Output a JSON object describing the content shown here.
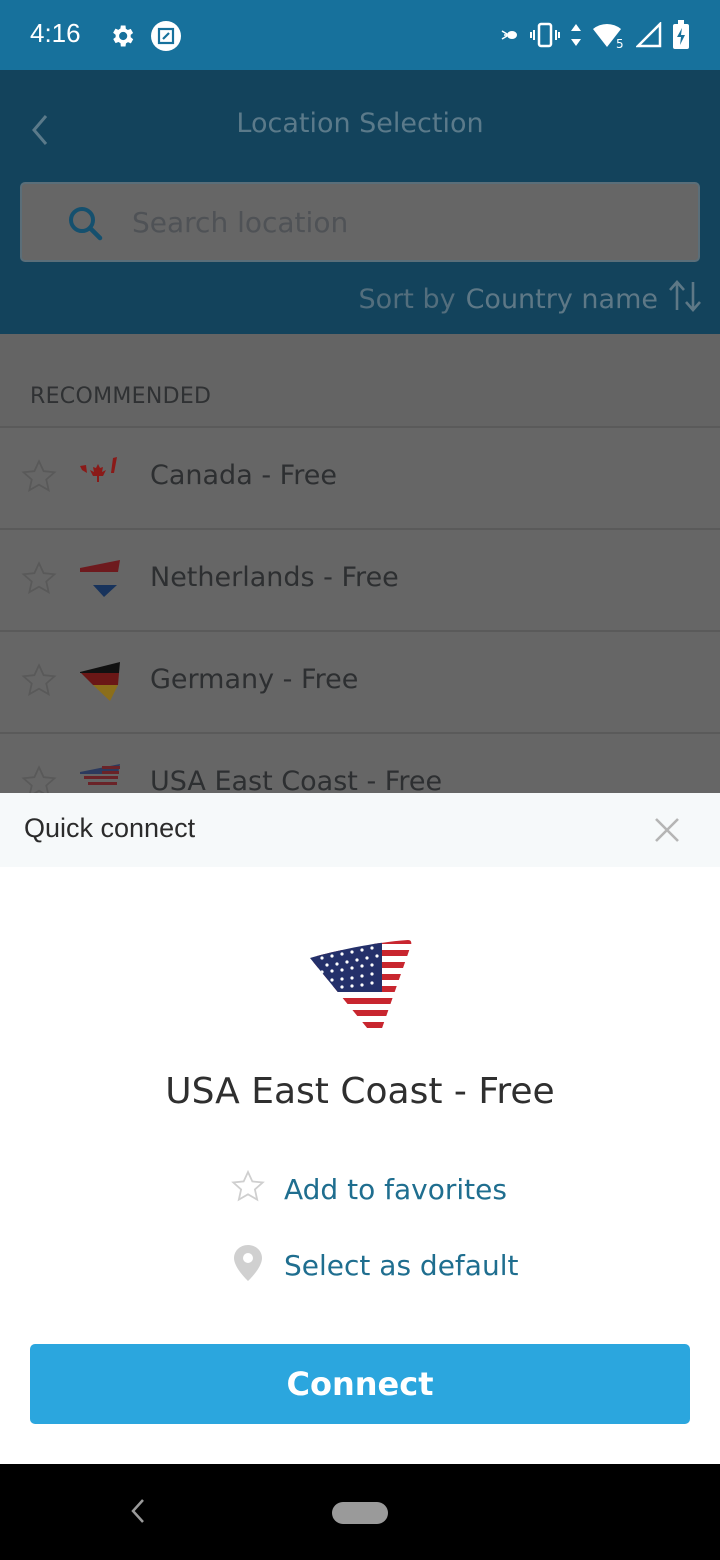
{
  "status_bar": {
    "time": "4:16",
    "left_icons": [
      "settings-icon",
      "screenshot-icon"
    ],
    "right_icons": [
      "bug-icon",
      "vibrate-icon",
      "data-arrows-icon",
      "wifi-icon",
      "signal-icon",
      "battery-charging-icon"
    ],
    "wifi_badge": "5"
  },
  "header": {
    "title": "Location Selection",
    "back_icon": "chevron-left-icon"
  },
  "search": {
    "placeholder": "Search location",
    "value": ""
  },
  "sort": {
    "label": "Sort by",
    "value": "Country name",
    "icon": "sort-arrows-icon"
  },
  "list": {
    "section_title": "RECOMMENDED",
    "items": [
      {
        "label": "Canada - Free",
        "flag": "canada"
      },
      {
        "label": "Netherlands - Free",
        "flag": "netherlands"
      },
      {
        "label": "Germany - Free",
        "flag": "germany"
      },
      {
        "label": "USA East Coast - Free",
        "flag": "usa"
      }
    ]
  },
  "quick_connect": {
    "title": "Quick connect",
    "location": "USA East Coast - Free",
    "flag": "usa",
    "add_favorites": "Add to favorites",
    "select_default": "Select as default",
    "connect": "Connect"
  },
  "colors": {
    "status_bar": "#17719c",
    "accent": "#2ba6de",
    "link": "#1f6e8f"
  }
}
